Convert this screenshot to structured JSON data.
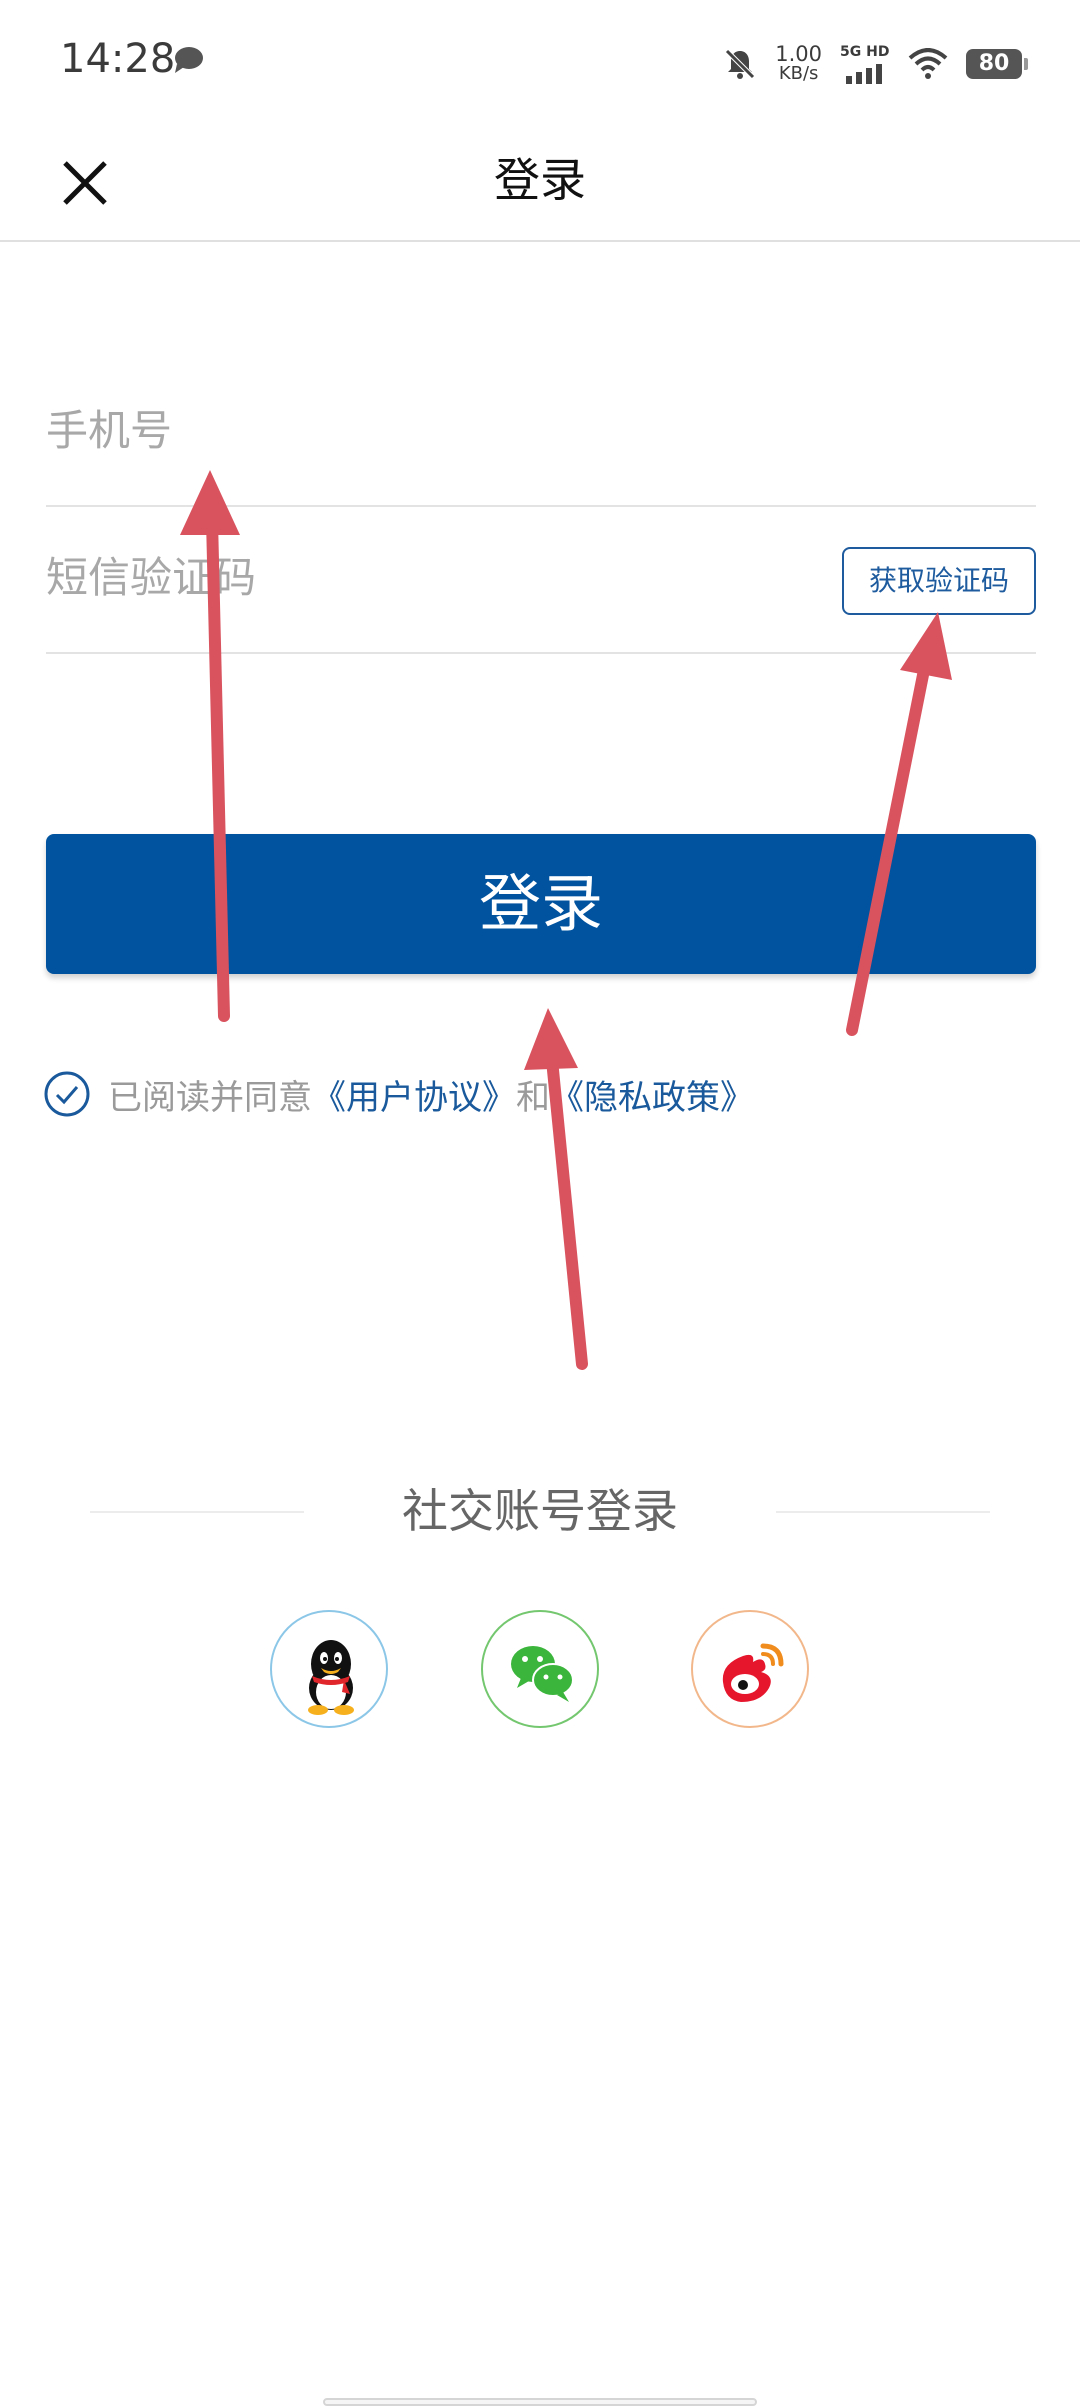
{
  "status_bar": {
    "time": "14:28",
    "net_speed_value": "1.00",
    "net_speed_unit": "KB/s",
    "network_label": "5G HD",
    "battery": "80"
  },
  "header": {
    "title": "登录"
  },
  "form": {
    "phone_placeholder": "手机号",
    "sms_placeholder": "短信验证码",
    "get_code_label": "获取验证码",
    "login_label": "登录"
  },
  "agreement": {
    "prefix": "已阅读并同意",
    "user_agreement": "《用户协议》",
    "conjunction": "和",
    "privacy_policy": "《隐私政策》",
    "checked": true
  },
  "social": {
    "title": "社交账号登录",
    "providers": [
      "qq-icon",
      "wechat-icon",
      "weibo-icon"
    ]
  },
  "colors": {
    "primary": "#01539f",
    "link": "#1a5a9c",
    "placeholder": "#a8a8a8",
    "annotation_arrow": "#d9535f"
  }
}
